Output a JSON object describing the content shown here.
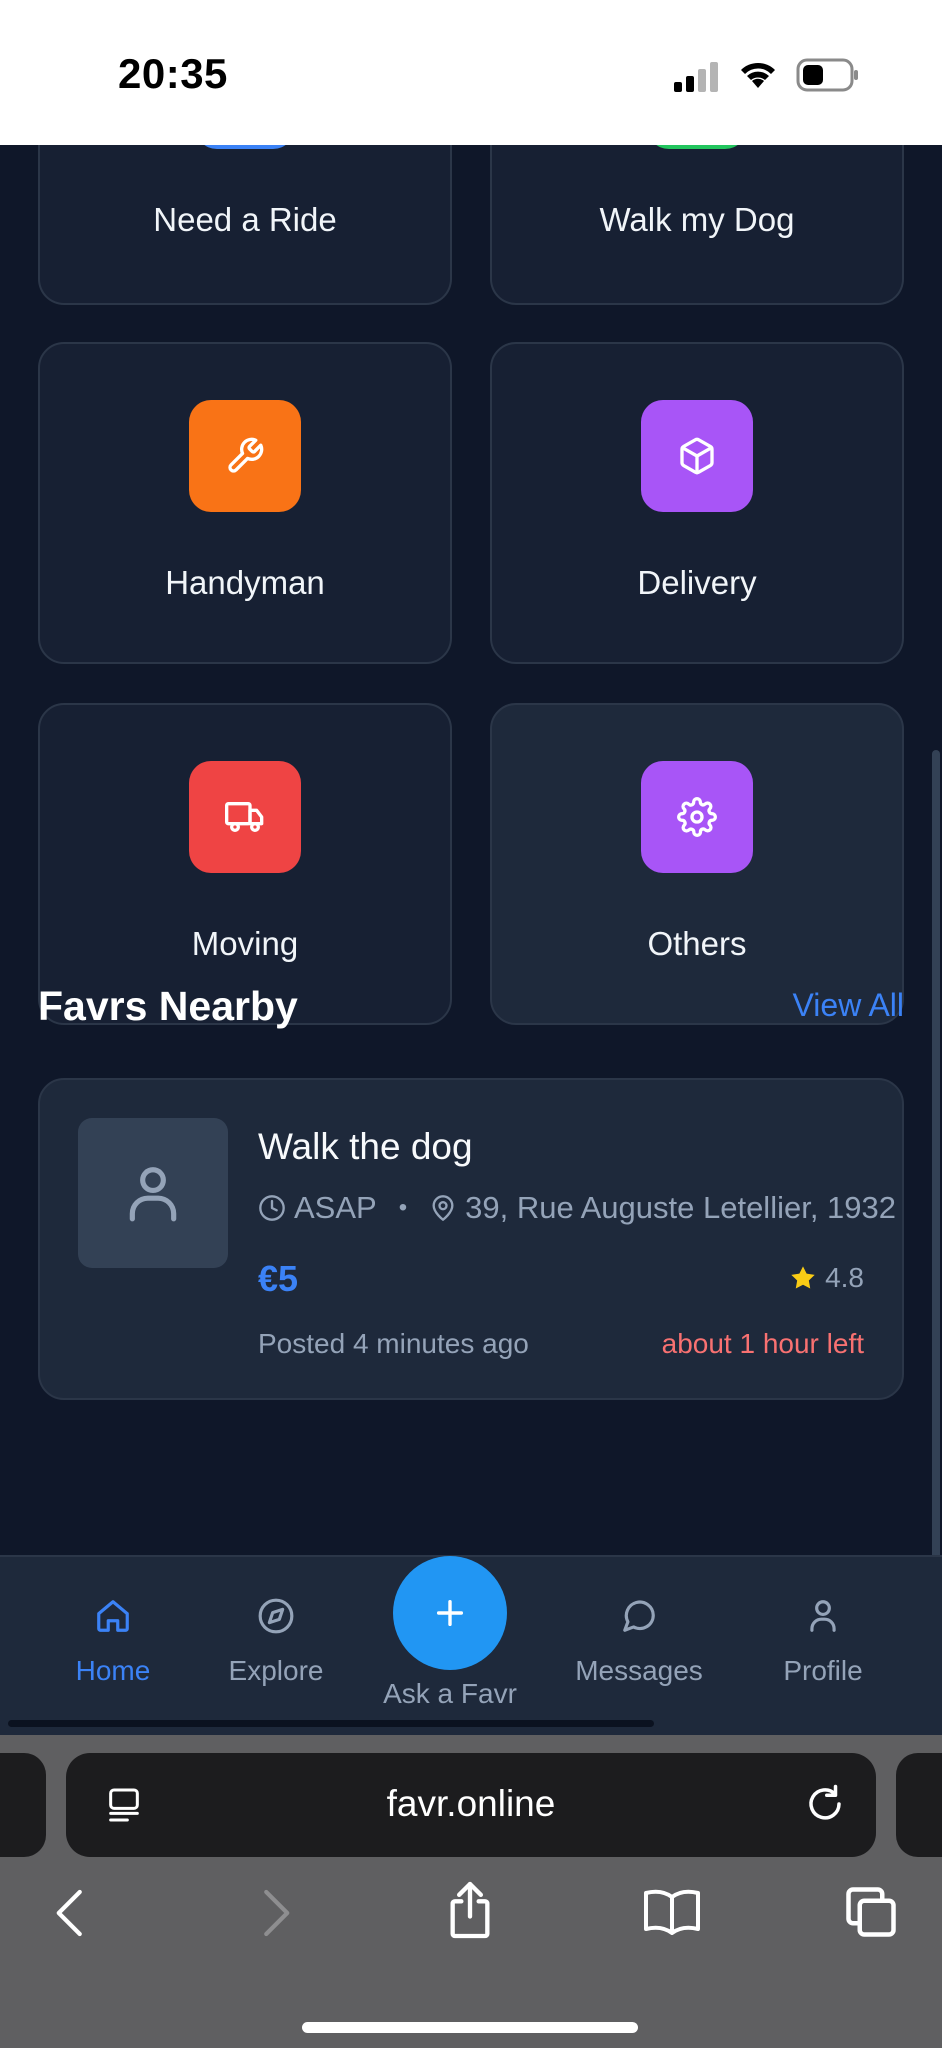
{
  "status_bar": {
    "time": "20:35"
  },
  "categories": [
    {
      "label": "Need a Ride",
      "icon": "car-icon",
      "color": "#3b82f6"
    },
    {
      "label": "Walk my Dog",
      "icon": "dog-icon",
      "color": "#22c55e"
    },
    {
      "label": "Handyman",
      "icon": "wrench-icon",
      "color": "#f97316"
    },
    {
      "label": "Delivery",
      "icon": "package-icon",
      "color": "#a855f7"
    },
    {
      "label": "Moving",
      "icon": "truck-icon",
      "color": "#ef4444"
    },
    {
      "label": "Others",
      "icon": "gear-icon",
      "color": "#a855f7"
    }
  ],
  "nearby": {
    "title": "Favrs Nearby",
    "view_all": "View All",
    "items": [
      {
        "title": "Walk the dog",
        "timing": "ASAP",
        "separator": "•",
        "location": "39, Rue Auguste Letellier, 1932",
        "price": "€5",
        "rating": "4.8",
        "posted": "Posted 4 minutes ago",
        "time_left": "about 1 hour left"
      }
    ]
  },
  "nav": {
    "home": "Home",
    "explore": "Explore",
    "ask": "Ask a Favr",
    "messages": "Messages",
    "profile": "Profile"
  },
  "browser": {
    "url": "favr.online"
  },
  "colors": {
    "background": "#0f1729",
    "card": "#1e293b",
    "accent": "#3b82f6",
    "fab": "#2196f3",
    "warning": "#f87171",
    "star": "#facc15"
  }
}
